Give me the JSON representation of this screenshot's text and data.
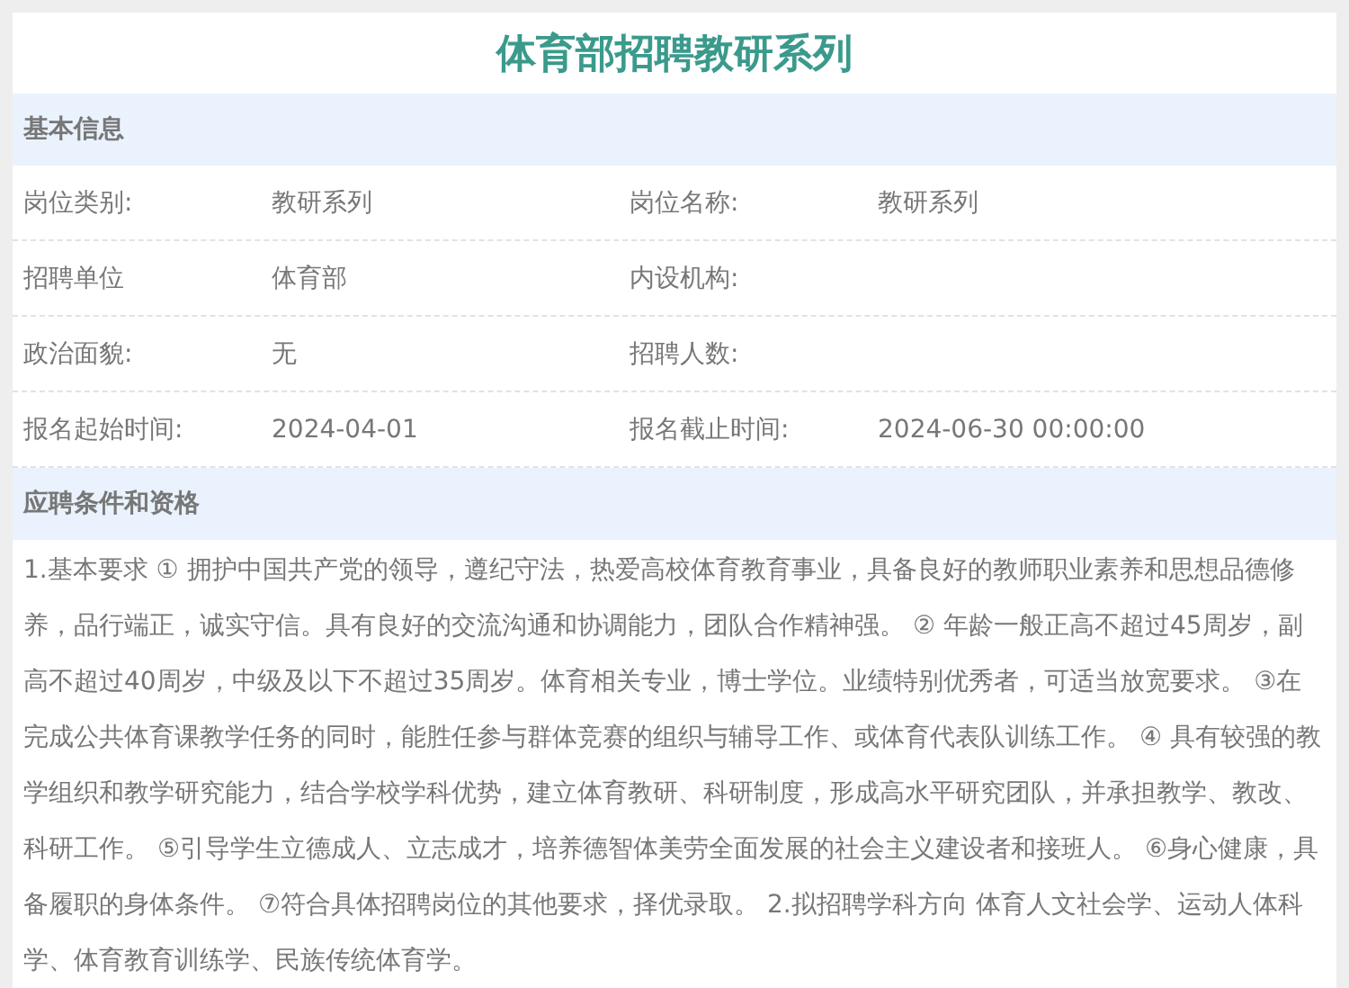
{
  "title": "体育部招聘教研系列",
  "sections": [
    {
      "kind": "fields",
      "heading": "基本信息",
      "rows": [
        {
          "cells": [
            {
              "label": "岗位类别:",
              "value": "教研系列"
            },
            {
              "label": "岗位名称:",
              "value": "教研系列"
            }
          ]
        },
        {
          "cells": [
            {
              "label": "招聘单位",
              "value": "体育部"
            },
            {
              "label": "内设机构:"
            }
          ]
        },
        {
          "cells": [
            {
              "label": "政治面貌:",
              "value": "无"
            },
            {
              "label": "招聘人数:"
            }
          ]
        },
        {
          "cells": [
            {
              "label": "报名起始时间:",
              "value": "2024-04-01"
            },
            {
              "label": "报名截止时间:",
              "value": "2024-06-30 00:00:00"
            }
          ]
        }
      ]
    },
    {
      "kind": "text",
      "heading": "应聘条件和资格",
      "text": "1.基本要求 ① 拥护中国共产党的领导，遵纪守法，热爱高校体育教育事业，具备良好的教师职业素养和思想品德修养，品行端正，诚实守信。具有良好的交流沟通和协调能力，团队合作精神强。 ② 年龄一般正高不超过45周岁，副高不超过40周岁，中级及以下不超过35周岁。体育相关专业，博士学位。业绩特别优秀者，可适当放宽要求。 ③在完成公共体育课教学任务的同时，能胜任参与群体竞赛的组织与辅导工作、或体育代表队训练工作。 ④ 具有较强的教学组织和教学研究能力，结合学校学科优势，建立体育教研、科研制度，形成高水平研究团队，并承担教学、教改、科研工作。 ⑤引导学生立德成人、立志成才，培养德智体美劳全面发展的社会主义建设者和接班人。 ⑥身心健康，具备履职的身体条件。 ⑦符合具体招聘岗位的其他要求，择优录取。 2.拟招聘学科方向 体育人文社会学、运动人体科学、体育教育训练学、民族传统体育学。"
    }
  ]
}
